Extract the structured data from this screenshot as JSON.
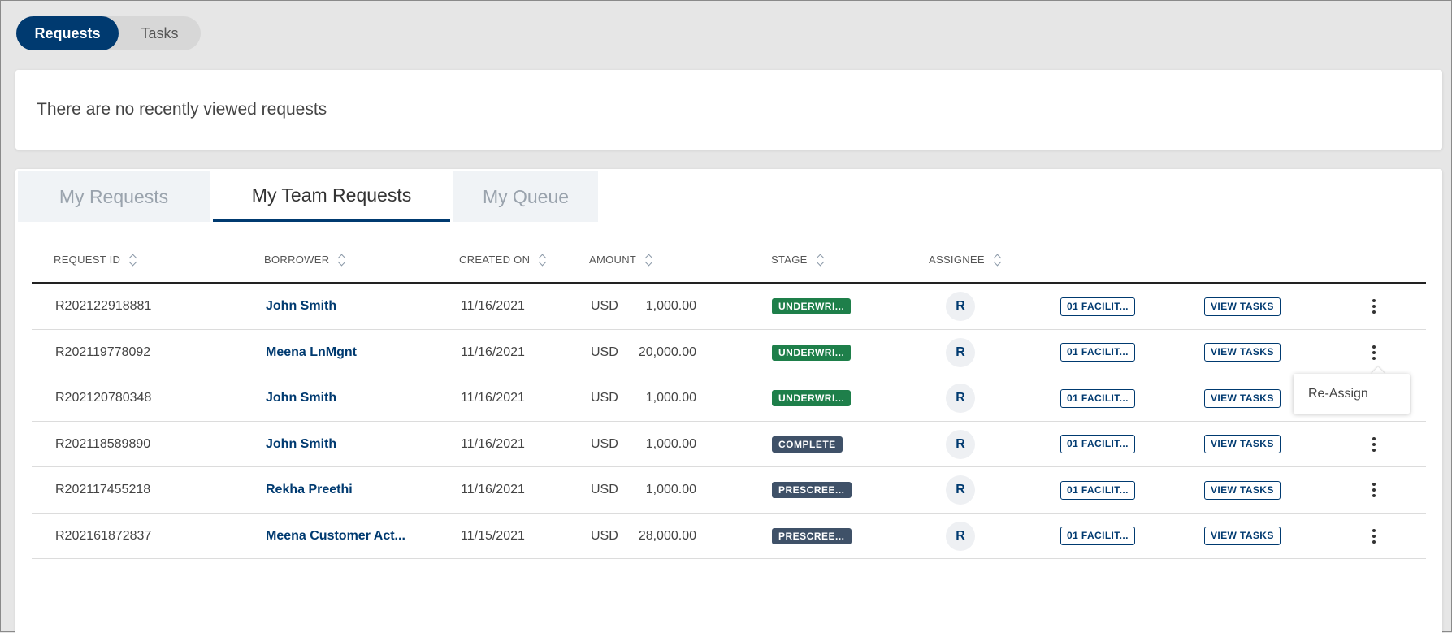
{
  "segments": [
    {
      "label": "Requests",
      "active": true
    },
    {
      "label": "Tasks",
      "active": false
    }
  ],
  "recent": {
    "empty_text": "There are no recently viewed requests"
  },
  "tabs": [
    {
      "label": "My Requests",
      "selected": false
    },
    {
      "label": "My Team Requests",
      "selected": true
    },
    {
      "label": "My Queue",
      "selected": false
    }
  ],
  "table": {
    "columns": [
      "REQUEST ID",
      "BORROWER",
      "CREATED ON",
      "AMOUNT",
      "STAGE",
      "ASSIGNEE"
    ],
    "rows": [
      {
        "id": "R202122918881",
        "borrower": "John Smith",
        "created": "11/16/2021",
        "currency": "USD",
        "amount": "1,000.00",
        "stage": "UNDERWRI...",
        "stage_color": "#1e7f4a",
        "assignee": "R",
        "facility": "01 FACILIT...",
        "tasks": "VIEW TASKS"
      },
      {
        "id": "R202119778092",
        "borrower": "Meena LnMgnt",
        "created": "11/16/2021",
        "currency": "USD",
        "amount": "20,000.00",
        "stage": "UNDERWRI...",
        "stage_color": "#1e7f4a",
        "assignee": "R",
        "facility": "01 FACILIT...",
        "tasks": "VIEW TASKS"
      },
      {
        "id": "R202120780348",
        "borrower": "John Smith",
        "created": "11/16/2021",
        "currency": "USD",
        "amount": "1,000.00",
        "stage": "UNDERWRI...",
        "stage_color": "#1e7f4a",
        "assignee": "R",
        "facility": "01 FACILIT...",
        "tasks": "VIEW TASKS"
      },
      {
        "id": "R202118589890",
        "borrower": "John Smith",
        "created": "11/16/2021",
        "currency": "USD",
        "amount": "1,000.00",
        "stage": "COMPLETE",
        "stage_color": "#3f5168",
        "assignee": "R",
        "facility": "01 FACILIT...",
        "tasks": "VIEW TASKS"
      },
      {
        "id": "R202117455218",
        "borrower": "Rekha Preethi",
        "created": "11/16/2021",
        "currency": "USD",
        "amount": "1,000.00",
        "stage": "PRESCREE...",
        "stage_color": "#3f5168",
        "assignee": "R",
        "facility": "01 FACILIT...",
        "tasks": "VIEW TASKS"
      },
      {
        "id": "R202161872837",
        "borrower": "Meena Customer Act...",
        "created": "11/15/2021",
        "currency": "USD",
        "amount": "28,000.00",
        "stage": "PRESCREE...",
        "stage_color": "#3f5168",
        "assignee": "R",
        "facility": "01 FACILIT...",
        "tasks": "VIEW TASKS"
      }
    ]
  },
  "popover": {
    "label": "Re-Assign"
  },
  "colors": {
    "primary": "#003a70",
    "stage_green": "#1e7f4a",
    "stage_slate": "#3f5168"
  }
}
